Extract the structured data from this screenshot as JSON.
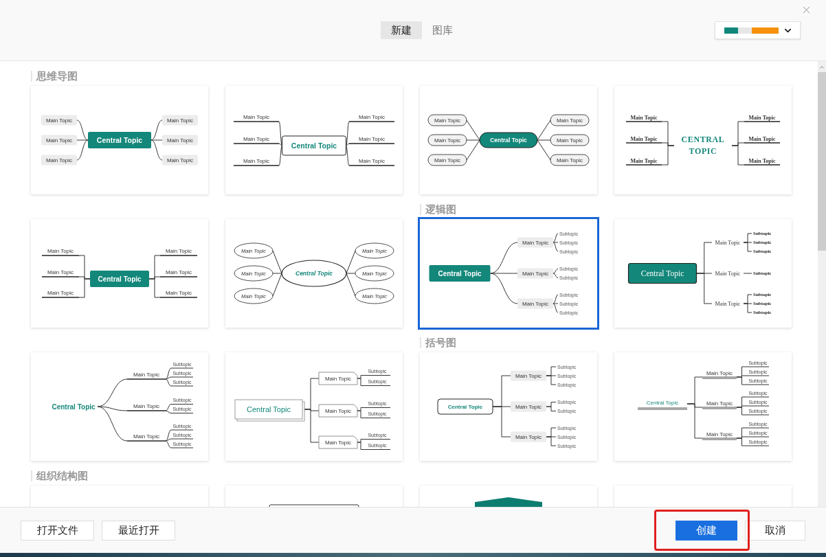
{
  "tabs": [
    {
      "label": "新建",
      "selected": true
    },
    {
      "label": "图库",
      "selected": false
    }
  ],
  "theme_picker": {
    "swatches": [
      {
        "color": "#10877a"
      },
      {
        "color": "#e6e6e6"
      },
      {
        "color": "#f5910a"
      }
    ]
  },
  "sections": [
    {
      "title": "思维导图",
      "templates": [
        {
          "kind": "map1",
          "selected": false,
          "central": "Central Topic",
          "topics": [
            {
              "label": "Main Topic"
            },
            {
              "label": "Main Topic"
            },
            {
              "label": "Main Topic"
            },
            {
              "label": "Main Topic"
            },
            {
              "label": "Main Topic"
            },
            {
              "label": "Main Topic"
            }
          ]
        },
        {
          "kind": "map2",
          "selected": false,
          "central": "Central Topic",
          "topics": [
            {
              "label": "Main Topic"
            },
            {
              "label": "Main Topic"
            },
            {
              "label": "Main Topic"
            },
            {
              "label": "Main Topic"
            },
            {
              "label": "Main Topic"
            },
            {
              "label": "Main Topic"
            }
          ]
        },
        {
          "kind": "map3",
          "selected": false,
          "central": "Central Topic",
          "topics": [
            {
              "label": "Main Topic"
            },
            {
              "label": "Main Topic"
            },
            {
              "label": "Main Topic"
            },
            {
              "label": "Main Topic"
            },
            {
              "label": "Main Topic"
            },
            {
              "label": "Main Topic"
            }
          ]
        },
        {
          "kind": "map4",
          "selected": false,
          "central": "CENTRAL TOPIC",
          "topics": [
            {
              "label": "Main Topic"
            },
            {
              "label": "Main Topic"
            },
            {
              "label": "Main Topic"
            },
            {
              "label": "Main Topic"
            },
            {
              "label": "Main Topic"
            },
            {
              "label": "Main Topic"
            }
          ]
        },
        {
          "kind": "map5",
          "selected": false,
          "central": "Central Topic",
          "topics": [
            {
              "label": "Main Topic"
            },
            {
              "label": "Main Topic"
            },
            {
              "label": "Main Topic"
            },
            {
              "label": "Main Topic"
            },
            {
              "label": "Main Topic"
            },
            {
              "label": "Main Topic"
            }
          ]
        },
        {
          "kind": "map6",
          "selected": false,
          "central": "Central Topic",
          "topics": [
            {
              "label": "Main Topic"
            },
            {
              "label": "Main Topic"
            },
            {
              "label": "Main Topic"
            },
            {
              "label": "Main Topic"
            },
            {
              "label": "Main Topic"
            },
            {
              "label": "Main Topic"
            }
          ]
        }
      ]
    },
    {
      "title": "逻辑图",
      "templates": [
        {
          "kind": "logic1",
          "selected": true,
          "central": "Central Topic",
          "topics": [
            {
              "label": "Main Topic",
              "subtopics": [
                "Subtopic",
                "Subtopic",
                "Subtopic"
              ]
            },
            {
              "label": "Main Topic",
              "subtopics": [
                "Subtopic",
                "Subtopic"
              ]
            },
            {
              "label": "Main Topic",
              "subtopics": [
                "Subtopic",
                "Subtopic",
                "Subtopic"
              ]
            }
          ]
        },
        {
          "kind": "logic2",
          "selected": false,
          "central": "Central Topic",
          "topics": [
            {
              "label": "Main Topic",
              "subtopics": [
                "Subtopic",
                "Subtopic",
                "Subtopic"
              ]
            },
            {
              "label": "Main Topic",
              "subtopics": [
                "Subtopic"
              ]
            },
            {
              "label": "Main Topic",
              "subtopics": [
                "Subtopic",
                "Subtopic",
                "Subtopic"
              ]
            }
          ]
        },
        {
          "kind": "logic3",
          "selected": false,
          "central": "Central Topic",
          "topics": [
            {
              "label": "Main Topic",
              "subtopics": [
                "Subtopic",
                "Subtopic",
                "Subtopic"
              ]
            },
            {
              "label": "Main Topic",
              "subtopics": [
                "Subtopic",
                "Subtopic"
              ]
            },
            {
              "label": "Main Topic",
              "subtopics": [
                "Subtopic",
                "Subtopic",
                "Subtopic"
              ]
            }
          ]
        },
        {
          "kind": "logic4",
          "selected": false,
          "central": "Central Topic",
          "topics": [
            {
              "label": "Main Topic",
              "subtopics": [
                "Subtopic",
                "Subtopic"
              ]
            },
            {
              "label": "Main Topic",
              "subtopics": [
                "Subtopic",
                "Subtopic"
              ]
            },
            {
              "label": "Main Topic",
              "subtopics": [
                "Subtopic",
                "Subtopic"
              ]
            }
          ]
        }
      ]
    },
    {
      "title": "括号图",
      "templates": [
        {
          "kind": "brace1",
          "selected": false,
          "central": "Central Topic",
          "topics": [
            {
              "label": "Main Topic",
              "subtopics": [
                "Subtopic",
                "Subtopic",
                "Subtopic"
              ]
            },
            {
              "label": "Main Topic",
              "subtopics": [
                "Subtopic",
                "Subtopic"
              ]
            },
            {
              "label": "Main Topic",
              "subtopics": [
                "Subtopic",
                "Subtopic",
                "Subtopic"
              ]
            }
          ]
        },
        {
          "kind": "brace2",
          "selected": false,
          "central": "Central Topic",
          "topics": [
            {
              "label": "Main Topic",
              "subtopics": [
                "Subtopic",
                "Subtopic",
                "Subtopic"
              ]
            },
            {
              "label": "Main Topic",
              "subtopics": [
                "Subtopic",
                "Subtopic",
                "Subtopic"
              ]
            },
            {
              "label": "Main Topic",
              "subtopics": [
                "Subtopic",
                "Subtopic",
                "Subtopic"
              ]
            }
          ]
        }
      ]
    },
    {
      "title": "组织结构图",
      "templates": [
        {
          "kind": "org1",
          "selected": false
        },
        {
          "kind": "org2",
          "selected": false
        },
        {
          "kind": "org3",
          "selected": false
        },
        {
          "kind": "org4",
          "selected": false
        }
      ]
    }
  ],
  "footer": {
    "left_buttons": [
      "打开文件",
      "最近打开"
    ],
    "right_buttons": [
      {
        "label": "创建",
        "kind": "primary"
      },
      {
        "label": "取消",
        "kind": "default"
      }
    ]
  }
}
